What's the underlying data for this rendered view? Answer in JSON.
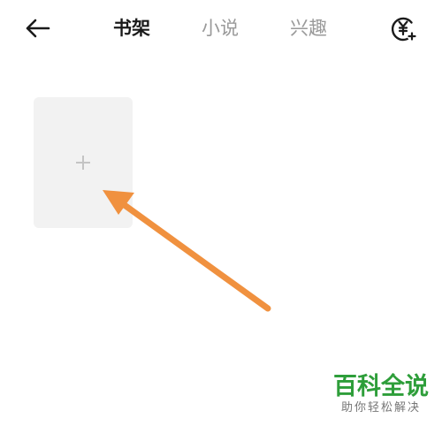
{
  "header": {
    "back_icon": "arrow-left-icon",
    "tabs": [
      {
        "label": "书架",
        "active": true
      },
      {
        "label": "小说",
        "active": false
      },
      {
        "label": "兴趣",
        "active": false
      }
    ],
    "coin_icon": "yuan-coin-plus-icon"
  },
  "bookshelf": {
    "add_card_icon": "plus-icon"
  },
  "annotation": {
    "arrow_color": "#f0913f"
  },
  "watermark": {
    "title": "百科全说",
    "subtitle": "助你轻松解决",
    "title_color": "#2e9e3a"
  },
  "colors": {
    "active_tab": "#1a1a1a",
    "inactive_tab": "#9a9a9a",
    "card_bg": "#f2f2f2",
    "plus": "#c4c4c4"
  }
}
